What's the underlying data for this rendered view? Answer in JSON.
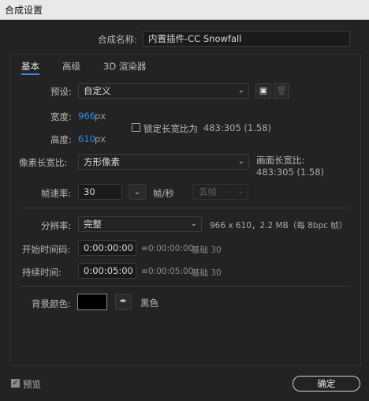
{
  "window": {
    "title": "合成设置"
  },
  "comp_name": {
    "label": "合成名称:",
    "value": "内置插件-CC Snowfall"
  },
  "tabs": [
    {
      "label": "基本",
      "active": true
    },
    {
      "label": "高级",
      "active": false
    },
    {
      "label": "3D 渲染器",
      "active": false
    }
  ],
  "preset": {
    "label": "预设:",
    "value": "自定义"
  },
  "width": {
    "label": "宽度:",
    "value": "966",
    "unit": "px"
  },
  "height": {
    "label": "高度:",
    "value": "610",
    "unit": "px"
  },
  "lock_aspect": {
    "label": "锁定长宽比为",
    "ratio": "483:305 (1.58)",
    "checked": false
  },
  "pixel_aspect": {
    "label": "像素长宽比:",
    "value": "方形像素"
  },
  "frame_aspect": {
    "label": "画面长宽比:",
    "value": "483:305 (1.58)"
  },
  "frame_rate": {
    "label": "帧速率:",
    "value": "30",
    "unit": "帧/秒",
    "drop_frame": "丢帧"
  },
  "resolution": {
    "label": "分辨率:",
    "value": "完整",
    "info": "966 x 610，2.2 MB（每 8bpc 帧）"
  },
  "start_timecode": {
    "label": "开始时间码:",
    "value": "0:00:00:00",
    "equals": "0:00:00:00",
    "base": "基础 30"
  },
  "duration": {
    "label": "持续时间:",
    "value": "0:00:05:00",
    "equals": "0:00:05:00",
    "base": "基础 30"
  },
  "background": {
    "label": "背景颜色:",
    "color": "#000000",
    "name": "黑色"
  },
  "preview": {
    "label": "预览",
    "checked": true
  },
  "ok_button": {
    "label": "确定"
  },
  "colors": {
    "accent": "#2d8ceb",
    "tab_underline": "#3b87d8",
    "background": "#232323"
  }
}
